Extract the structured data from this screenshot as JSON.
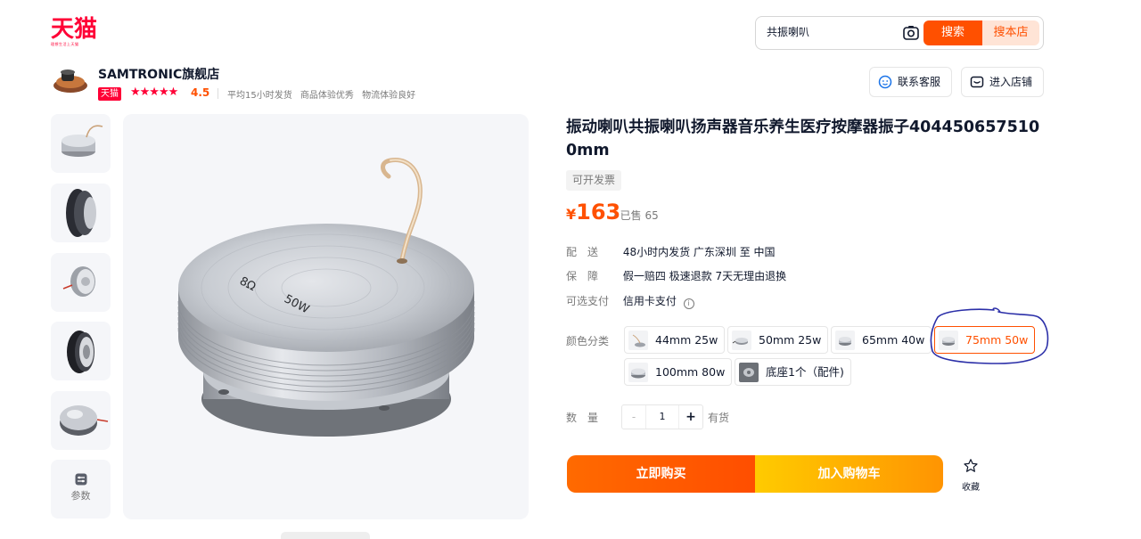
{
  "header": {
    "logo_text": "天猫",
    "logo_slogan": "理想生活上天猫",
    "search": {
      "value": "共振喇叭",
      "search_label": "搜索",
      "shop_search_label": "搜本店"
    }
  },
  "store": {
    "name": "SAMTRONIC旗舰店",
    "badge": "天猫",
    "stars": "★★★★★",
    "rating": "4.5",
    "metrics": [
      "平均15小时发货",
      "商品体验优秀",
      "物流体验良好"
    ],
    "contact_label": "联系客服",
    "enter_label": "进入店铺"
  },
  "gallery": {
    "thumbnail_count": 5,
    "params_label": "参数",
    "main_image_marks": {
      "impedance": "8Ω",
      "power": "50W"
    }
  },
  "product": {
    "title": "振动喇叭共振喇叭扬声器音乐养生医疗按摩器振子4044506575100mm",
    "invoice_tag": "可开发票",
    "price_currency": "¥",
    "price_value": "163",
    "sold": "· 已售 65",
    "delivery": {
      "label": "配　送",
      "value": "48小时内发货  广东深圳  至  中国"
    },
    "guarantee": {
      "label": "保　障",
      "value": "假一赔四 极速退款 7天无理由退换"
    },
    "payment": {
      "label": "可选支付",
      "value": "信用卡支付"
    },
    "sku": {
      "label": "颜色分类",
      "options": [
        "44mm 25w",
        "50mm 25w",
        "65mm 40w",
        "75mm 50w",
        "100mm 80w",
        "底座1个（配件)"
      ],
      "selected": "75mm 50w"
    },
    "quantity": {
      "label": "数量",
      "value": "1",
      "minus": "-",
      "plus": "+",
      "stock": "有货"
    },
    "buy_now_label": "立即购买",
    "add_cart_label": "加入购物车",
    "favorite_label": "收藏"
  },
  "colors": {
    "brand_red": "#ff0036",
    "accent_orange": "#ff5000",
    "annotation_blue": "#2b2fa8"
  }
}
